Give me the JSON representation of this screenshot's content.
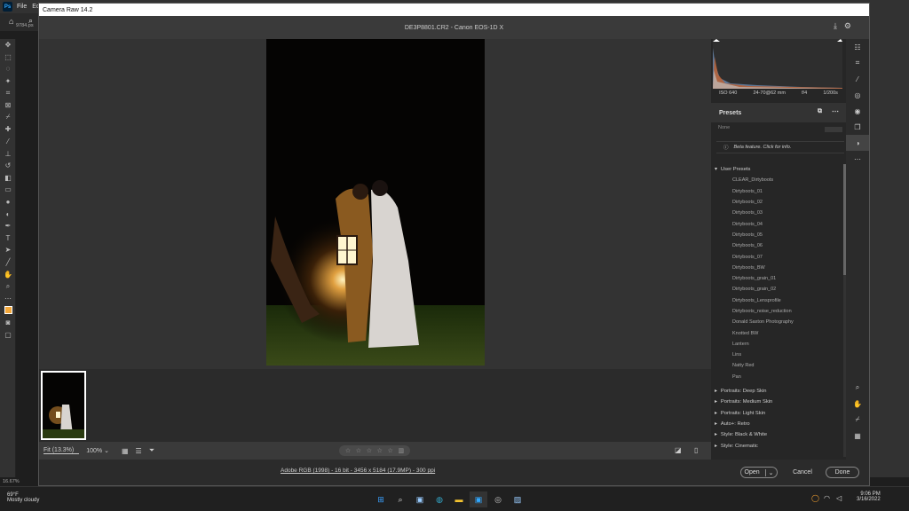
{
  "photoshop": {
    "logo": "Ps",
    "menu": [
      "File",
      "Ed"
    ],
    "doc_tab": "9784.ps",
    "zoom_readout": "16.67%"
  },
  "camera_raw": {
    "window_title": "Camera Raw 14.2",
    "file_title": "DE3P8801.CR2  -  Canon EOS-1D X",
    "zoom": {
      "fit": "Fit (13.3%)",
      "selected": "100%"
    },
    "exif": {
      "iso": "ISO 640",
      "lens": "24-70@62 mm",
      "aperture": "f/4",
      "shutter": "1/200s"
    },
    "presets": {
      "title": "Presets",
      "search_placeholder": "None",
      "beta_text": "Beta feature. Click for info.",
      "user_group": "User Presets",
      "user_items": [
        "CLEAR_Dirtyboots",
        "Dirtyboots_01",
        "Dirtyboots_02",
        "Dirtyboots_03",
        "Dirtyboots_04",
        "Dirtyboots_05",
        "Dirtyboots_06",
        "Dirtyboots_07",
        "Dirtyboots_BW",
        "Dirtyboots_grain_01",
        "Dirtyboots_grain_02",
        "Dirtyboots_Lensprofile",
        "Dirtyboots_noise_reduction",
        "Donald Saxton Photography",
        "Knotted BW",
        "Lantern",
        "Lins",
        "Natty Red",
        "Pan"
      ],
      "groups": [
        "Portraits: Deep Skin",
        "Portraits: Medium Skin",
        "Portraits: Light Skin",
        "Auto+: Retro",
        "Style: Black & White",
        "Style: Cinematic"
      ]
    },
    "workflow": "Adobe RGB (1998) - 16 bit - 3456 x 5184 (17.9MP) - 300 ppi",
    "buttons": {
      "open": "Open",
      "cancel": "Cancel",
      "done": "Done"
    }
  },
  "taskbar": {
    "temp": "69°F",
    "weather": "Mostly cloudy",
    "time": "9:06 PM",
    "date": "3/16/2022"
  },
  "colors": {
    "accent": "#31a8ff",
    "foreground_swatch": "#f4a83a"
  }
}
